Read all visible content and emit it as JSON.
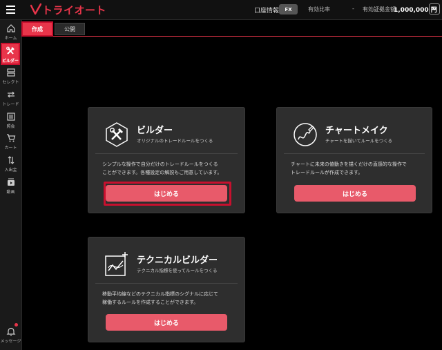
{
  "header": {
    "logo_text": "トライオート",
    "account_label": "口座情報",
    "fx_badge": "FX",
    "margin_label": "有効比率",
    "margin_value": "-",
    "effective_margin_label": "有効証拠金額",
    "effective_margin_value": "1,000,000 円"
  },
  "sidebar": {
    "items": [
      {
        "label": "ホーム",
        "icon": "home-icon"
      },
      {
        "label": "ビルダー",
        "icon": "tools-icon"
      },
      {
        "label": "セレクト",
        "icon": "select-icon"
      },
      {
        "label": "トレード",
        "icon": "trade-icon"
      },
      {
        "label": "照会",
        "icon": "list-icon"
      },
      {
        "label": "カート",
        "icon": "cart-icon"
      },
      {
        "label": "入出金",
        "icon": "transfer-icon"
      },
      {
        "label": "動画",
        "icon": "video-icon"
      },
      {
        "label": "メッセージ",
        "icon": "bell-icon"
      }
    ]
  },
  "tabs": [
    {
      "label": "作成",
      "active": true
    },
    {
      "label": "公開",
      "active": false
    }
  ],
  "cards": {
    "builder": {
      "title": "ビルダー",
      "subtitle": "オリジナルのトレードルールをつくる",
      "desc_line1": "シンプルな操作で自分だけのトレードルールをつくる",
      "desc_line2": "ことができます。各種設定の解説もご用意しています。",
      "button": "はじめる",
      "icon": "tools-icon"
    },
    "chart_make": {
      "title": "チャートメイク",
      "subtitle": "チャートを描いてルールをつくる",
      "desc_line1": "チャートに未来の値動きを描くだけの直感的な操作で",
      "desc_line2": "トレードルールが作成できます。",
      "button": "はじめる",
      "icon": "pen-chart-icon"
    },
    "technical": {
      "title": "テクニカルビルダー",
      "subtitle": "テクニカル指標を使ってルールをつくる",
      "desc_line1": "移動平均線などのテクニカル指標のシグナルに応じて",
      "desc_line2": "稼働するルールを作成することができます。",
      "button": "はじめる",
      "icon": "technical-chart-icon"
    }
  },
  "colors": {
    "accent": "#e8354a",
    "button": "#e85a6a",
    "highlight": "#c8102e",
    "card_bg": "#2e2e2e"
  }
}
